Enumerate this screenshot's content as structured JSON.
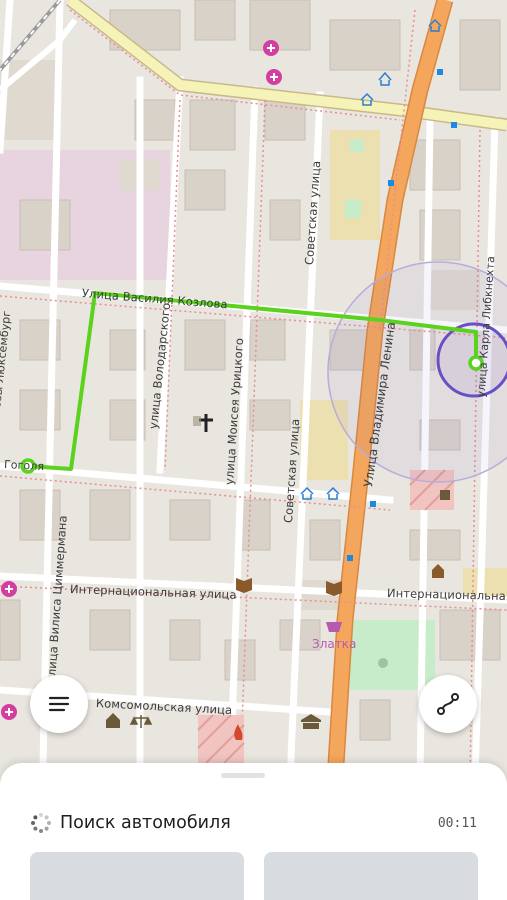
{
  "map": {
    "streets": {
      "vasiliya_kozlova": "Улица Василия Козлова",
      "volodarskogo": "улица Володарского",
      "moiseya_uritskogo": "улица Моисея Урицкого",
      "sovetskaya_top": "Советская улица",
      "sovetskaya_mid": "Советская улица",
      "vladimira_lenina": "Улица Владимира Ленина",
      "karla_libknekhta": "улица Карла Либкнехта",
      "lyuksemburg": "Розы Люксембург",
      "gogolya": "Гоголя",
      "internatsionalnaya_left": "Интернациональная улица",
      "internatsionalnaya_right": "Интернациональная",
      "vilisa_tsimmermana": "улица Вилиса Циммермана",
      "komsomolskaya": "Комсомольская улица"
    },
    "poi": {
      "zlatka": "Златка"
    },
    "colors": {
      "route": "#5ad21e",
      "main_road": "#f4a65c",
      "accuracy_circle": "#6a4fc4"
    }
  },
  "controls": {
    "menu_icon": "menu-icon",
    "route_icon": "route-icon"
  },
  "sheet": {
    "status_text": "Поиск автомобиля",
    "timer": "00:11"
  }
}
